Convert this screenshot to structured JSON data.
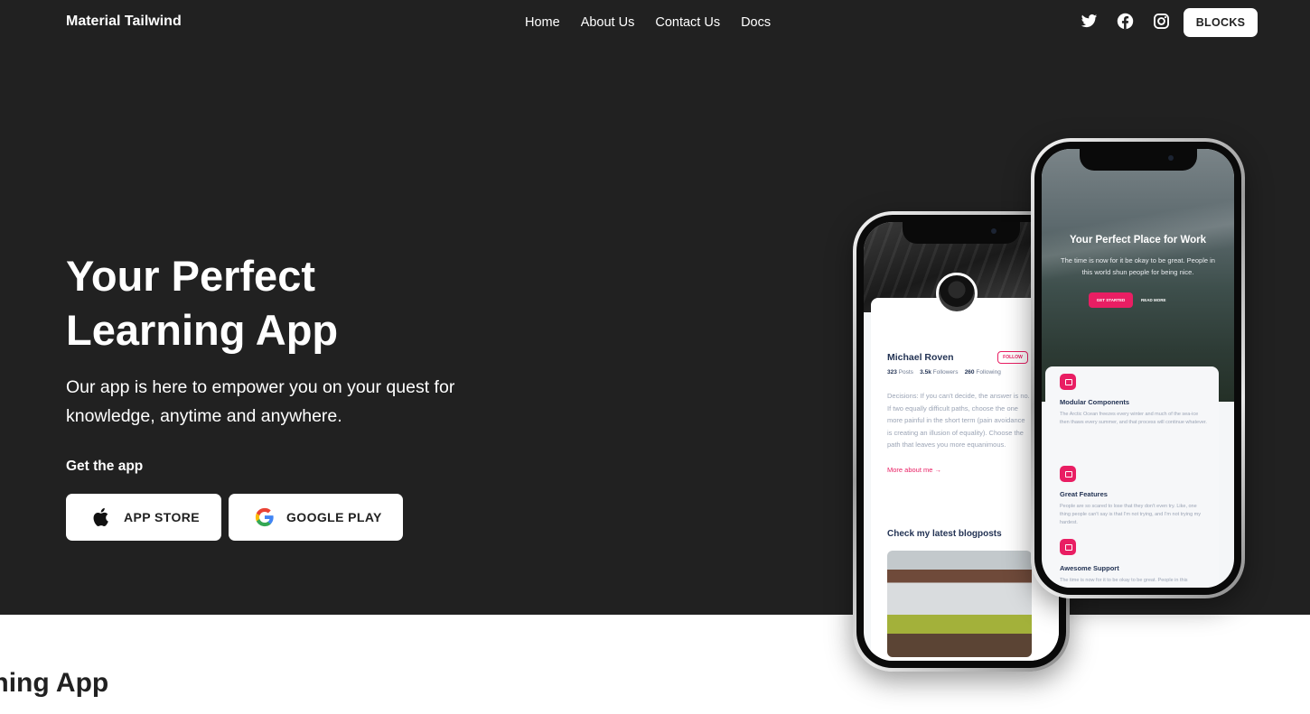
{
  "nav": {
    "brand": "Material Tailwind",
    "links": [
      "Home",
      "About Us",
      "Contact Us",
      "Docs"
    ],
    "socials": [
      "twitter-icon",
      "facebook-icon",
      "instagram-icon"
    ],
    "blocks_label": "BLOCKS"
  },
  "hero": {
    "title_line1": "Your Perfect",
    "title_line2": "Learning App",
    "description": "Our app is here to empower you on your quest for knowledge, anytime and anywhere.",
    "get_app": "Get the app",
    "app_store_label": "APP STORE",
    "google_play_label": "GOOGLE PLAY"
  },
  "phone_back": {
    "name": "Michael Roven",
    "follow": "FOLLOW",
    "posts_count": "323",
    "posts_label": "Posts",
    "followers_count": "3.5k",
    "followers_label": "Followers",
    "following_count": "260",
    "following_label": "Following",
    "bio": "Decisions: If you can't decide, the answer is no. If two equally difficult paths, choose the one more painful in the short term (pain avoidance is creating an illusion of equality). Choose the path that leaves you more equanimous.",
    "more": "More about me →",
    "blog_title": "Check my latest blogposts"
  },
  "phone_front": {
    "title": "Your Perfect Place for Work",
    "description": "The time is now for it be okay to be great. People in this world shun people for being nice.",
    "get_started": "GET STARTED",
    "read_more": "READ MORE",
    "features": [
      {
        "title": "Modular Components",
        "text": "The Arctic Ocean freezes every winter and much of the sea-ice then thaws every summer, and that process will continue whatever."
      },
      {
        "title": "Great Features",
        "text": "People are so scared to lose that they don't even try. Like, one thing people can't say is that I'm not trying, and I'm not trying my hardest."
      },
      {
        "title": "Awesome Support",
        "text": "The time is now for it to be okay to be great. People in this"
      }
    ]
  },
  "bottom": {
    "title": "Learning App"
  },
  "colors": {
    "hero_bg": "#212121",
    "accent": "#e91e63",
    "text_dark": "#233354"
  }
}
